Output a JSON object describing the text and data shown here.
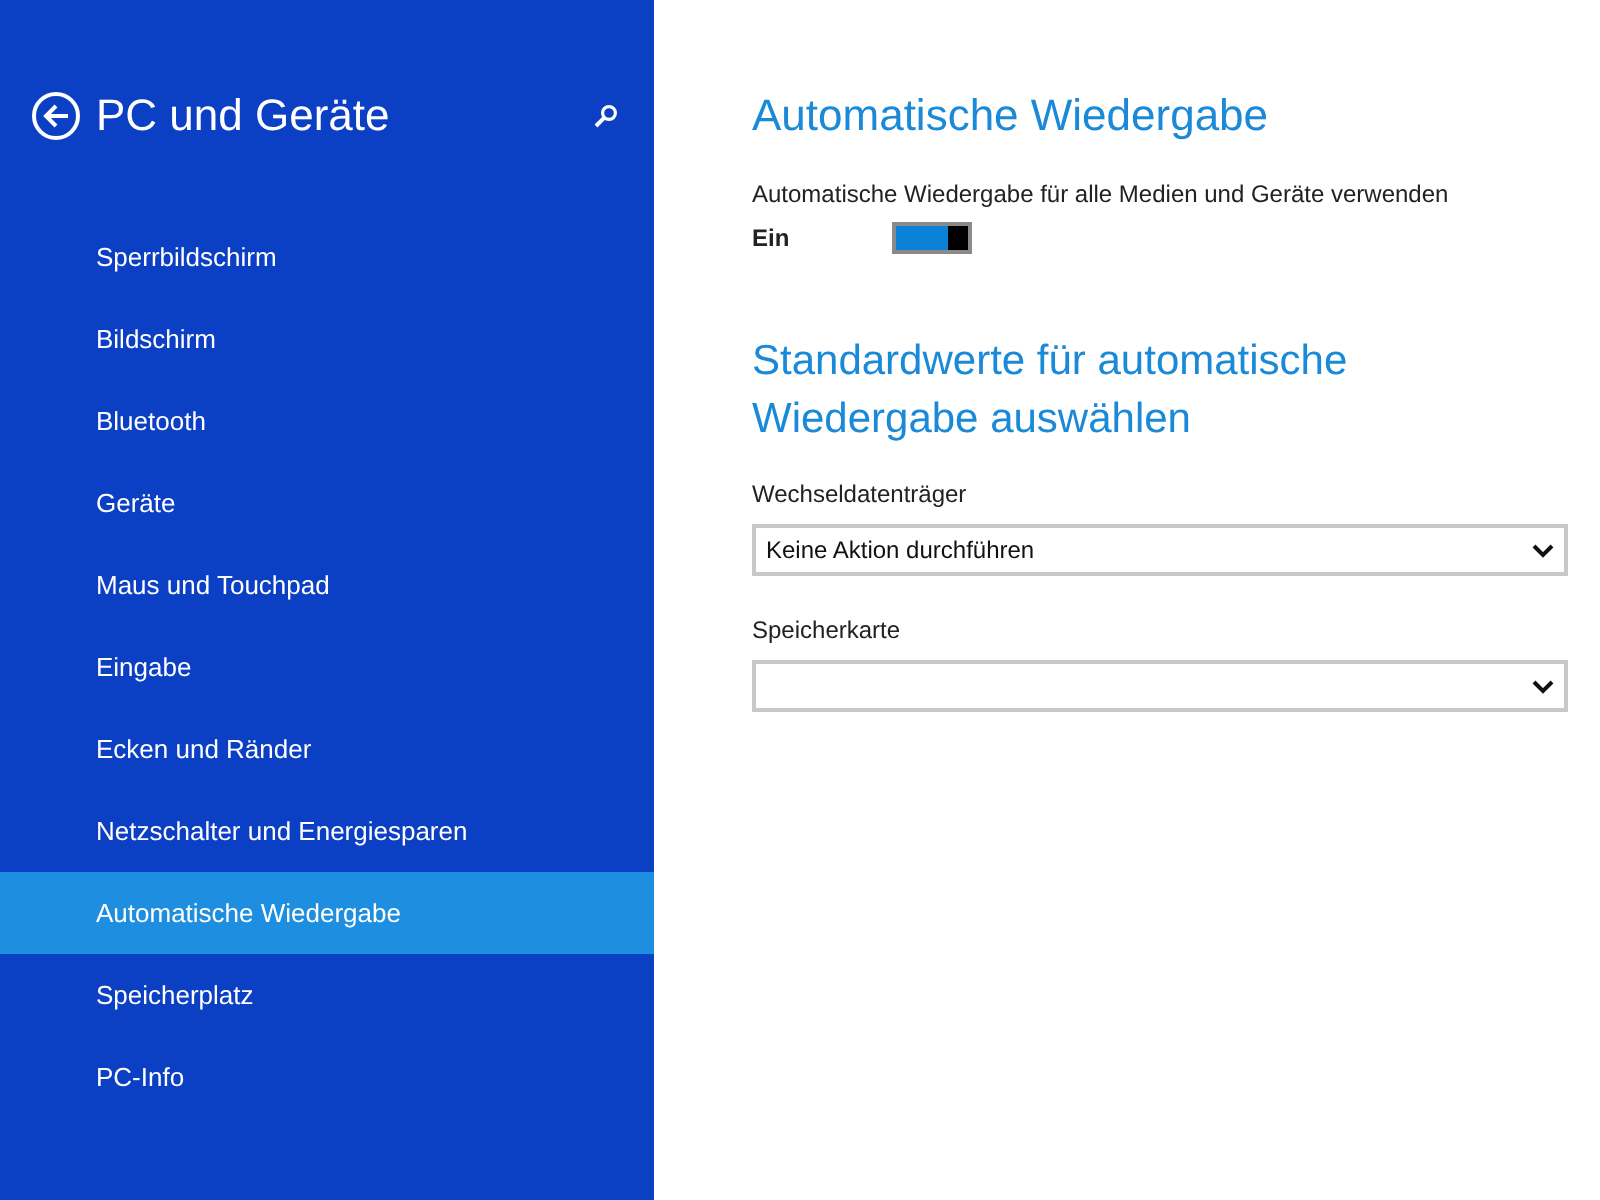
{
  "sidebar": {
    "title": "PC und Geräte",
    "items": [
      {
        "label": "Sperrbildschirm",
        "selected": false
      },
      {
        "label": "Bildschirm",
        "selected": false
      },
      {
        "label": "Bluetooth",
        "selected": false
      },
      {
        "label": "Geräte",
        "selected": false
      },
      {
        "label": "Maus und Touchpad",
        "selected": false
      },
      {
        "label": "Eingabe",
        "selected": false
      },
      {
        "label": "Ecken und Ränder",
        "selected": false
      },
      {
        "label": "Netzschalter und Energiesparen",
        "selected": false
      },
      {
        "label": "Automatische Wiedergabe",
        "selected": true
      },
      {
        "label": "Speicherplatz",
        "selected": false
      },
      {
        "label": "PC-Info",
        "selected": false
      }
    ]
  },
  "content": {
    "title": "Automatische Wiedergabe",
    "toggle": {
      "label": "Automatische Wiedergabe für alle Medien und Geräte verwenden",
      "state_text": "Ein",
      "on": true
    },
    "section_title": "Standardwerte für automatische Wiedergabe auswählen",
    "dropdowns": [
      {
        "label": "Wechseldatenträger",
        "value": "Keine Aktion durchführen"
      },
      {
        "label": "Speicherkarte"
      }
    ]
  }
}
